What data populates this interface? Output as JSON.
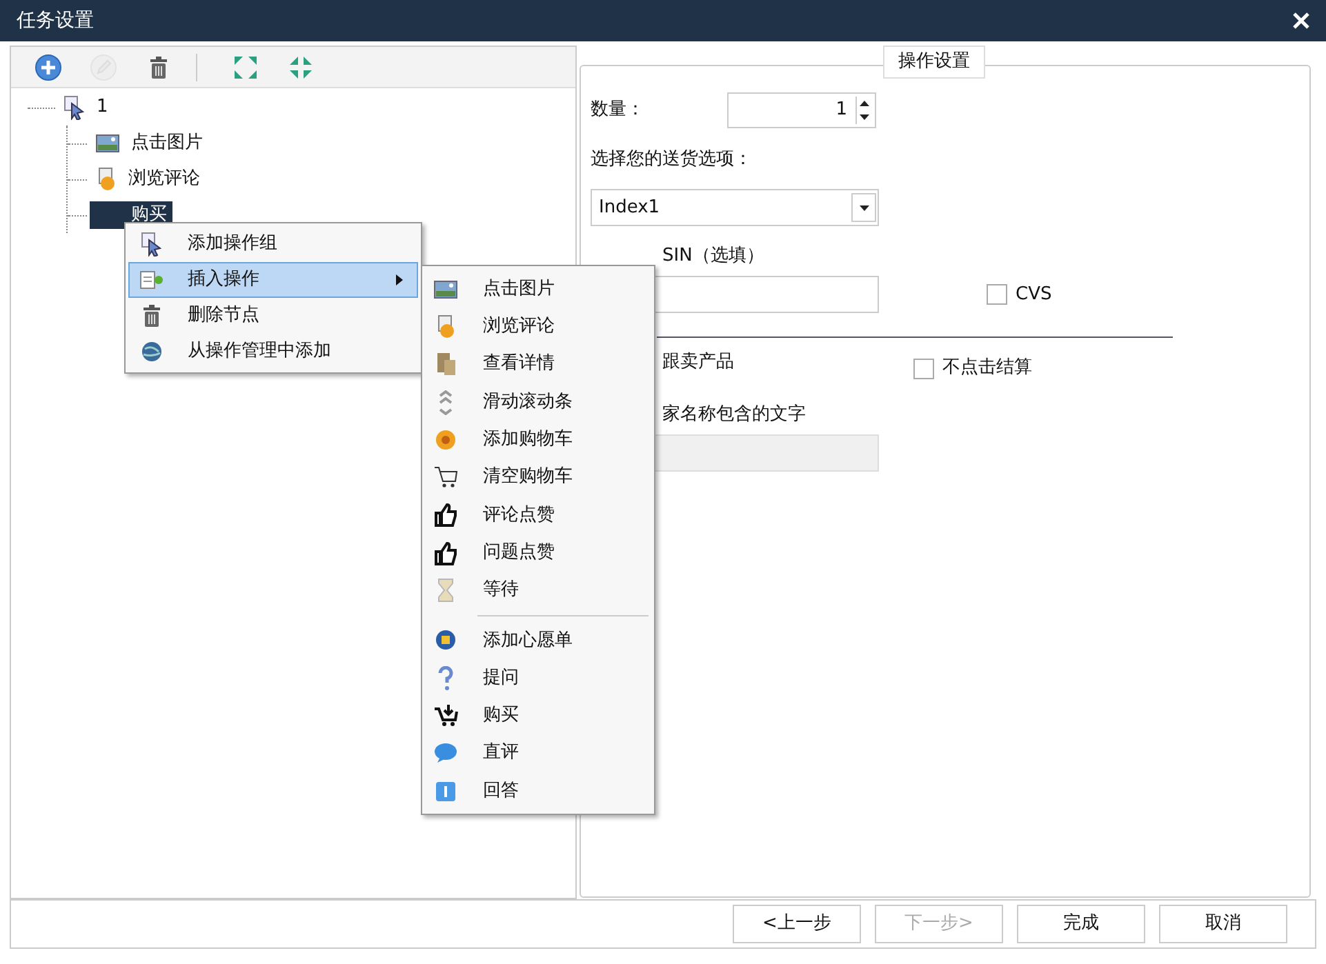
{
  "window": {
    "title": "任务设置"
  },
  "toolbar": [
    {
      "disabled": false
    },
    {
      "disabled": true
    },
    {
      "disabled": false
    },
    {
      "disabled": false
    },
    {
      "disabled": false
    }
  ],
  "tree": [
    {
      "label": "1",
      "selected": false,
      "children": [
        {
          "label": "点击图片",
          "selected": false
        },
        {
          "label": "浏览评论",
          "selected": false
        },
        {
          "label": "购买",
          "selected": true
        }
      ]
    }
  ],
  "group": {
    "legend": "操作设置"
  },
  "form": {
    "quantity_label": "数量：",
    "quantity": "1",
    "shipping_label": "选择您的送货选项：",
    "shipping": "Index1",
    "asin_label": "SIN（选填）",
    "cvs": {
      "label": "CVS",
      "checked": false
    },
    "follow_label": "跟卖产品",
    "no_checkout": {
      "label": "不点击结算",
      "checked": false
    },
    "seller_label": "家名称包含的文字"
  },
  "context_menu": [
    {
      "label": "添加操作组",
      "selected": false
    },
    {
      "label": "插入操作",
      "selected": true,
      "submenu": true
    },
    {
      "label": "删除节点",
      "selected": false
    },
    {
      "label": "从操作管理中添加",
      "selected": false
    }
  ],
  "submenu": [
    {
      "kind": "item",
      "label": "点击图片"
    },
    {
      "kind": "item",
      "label": "浏览评论"
    },
    {
      "kind": "item",
      "label": "查看详情"
    },
    {
      "kind": "item",
      "label": "滑动滚动条"
    },
    {
      "kind": "item",
      "label": "添加购物车"
    },
    {
      "kind": "item",
      "label": "清空购物车"
    },
    {
      "kind": "item",
      "label": "评论点赞"
    },
    {
      "kind": "item",
      "label": "问题点赞"
    },
    {
      "kind": "item",
      "label": "等待"
    },
    {
      "kind": "separator"
    },
    {
      "kind": "item",
      "label": "添加心愿单"
    },
    {
      "kind": "item",
      "label": "提问"
    },
    {
      "kind": "item",
      "label": "购买"
    },
    {
      "kind": "item",
      "label": "直评"
    },
    {
      "kind": "item",
      "label": "回答"
    }
  ],
  "buttons": [
    {
      "label": "<上一步",
      "disabled": false
    },
    {
      "label": "下一步>",
      "disabled": true
    },
    {
      "label": "完成",
      "disabled": false
    },
    {
      "label": "取消",
      "disabled": false
    }
  ]
}
